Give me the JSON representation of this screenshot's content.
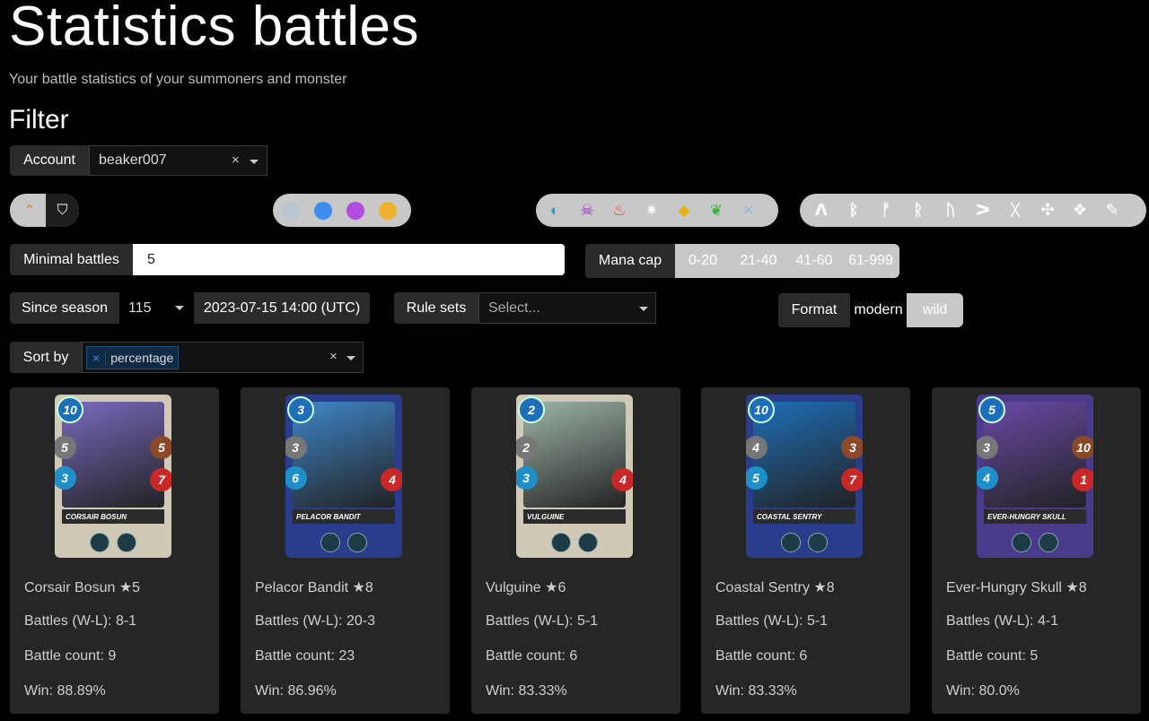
{
  "page": {
    "title": "Statistics battles",
    "subtitle": "Your battle statistics of your summoners and monster",
    "filter_heading": "Filter"
  },
  "filters": {
    "account_label": "Account",
    "account_value": "beaker007",
    "minimal_battles_label": "Minimal battles",
    "minimal_battles_value": "5",
    "mana_cap_label": "Mana cap",
    "mana_ranges": [
      "0-20",
      "21-40",
      "41-60",
      "61-999"
    ],
    "since_season_label": "Since season",
    "since_season_value": "115",
    "since_date": "2023-07-15 14:00 (UTC)",
    "rule_sets_label": "Rule sets",
    "rule_sets_placeholder": "Select...",
    "format_label": "Format",
    "format_options": [
      "modern",
      "wild"
    ],
    "format_selected": "wild",
    "sort_by_label": "Sort by",
    "sort_by_tag": "percentage",
    "card_type_icons": [
      "monster-icon",
      "summoner-icon"
    ],
    "rarity_colors": [
      "#b9c6d2",
      "#3c8cf0",
      "#b04ce0",
      "#f0b030"
    ],
    "element_icons": [
      "water-icon",
      "death-icon",
      "fire-icon",
      "life-icon",
      "earth-icon",
      "dragon-icon",
      "neutral-icon"
    ],
    "ability_icons": [
      "rune-1-icon",
      "rune-2-icon",
      "rune-3-icon",
      "rune-4-icon",
      "rune-5-icon",
      "rune-6-icon",
      "rune-7-icon",
      "rune-8-icon",
      "rune-9-icon",
      "rune-10-icon"
    ]
  },
  "cards": [
    {
      "name": "Corsair Bosun ★5",
      "plate": "CORSAIR BOSUN",
      "battles": "Battles (W-L): 8-1",
      "count": "Battle count: 9",
      "win": "Win: 88.89%",
      "mana": "10",
      "atk": "5",
      "speed": "3",
      "hp": "7",
      "armor": "5",
      "frame": "#cfc9b5",
      "art": "#7a6ac0"
    },
    {
      "name": "Pelacor Bandit ★8",
      "plate": "PELACOR BANDIT",
      "battles": "Battles (W-L): 20-3",
      "count": "Battle count: 23",
      "win": "Win: 86.96%",
      "mana": "3",
      "atk": "3",
      "speed": "6",
      "hp": "4",
      "armor": "",
      "frame": "#2a3c8c",
      "art": "#3f86c9"
    },
    {
      "name": "Vulguine ★6",
      "plate": "VULGUINE",
      "battles": "Battles (W-L): 5-1",
      "count": "Battle count: 6",
      "win": "Win: 83.33%",
      "mana": "2",
      "atk": "2",
      "speed": "3",
      "hp": "4",
      "armor": "",
      "frame": "#cfc9b5",
      "art": "#9fb5a8"
    },
    {
      "name": "Coastal Sentry ★8",
      "plate": "COASTAL SENTRY",
      "battles": "Battles (W-L): 5-1",
      "count": "Battle count: 6",
      "win": "Win: 83.33%",
      "mana": "10",
      "atk": "4",
      "speed": "5",
      "hp": "7",
      "armor": "3",
      "frame": "#2a3c8c",
      "art": "#1e6fb8"
    },
    {
      "name": "Ever-Hungry Skull ★8",
      "plate": "EVER-HUNGRY SKULL",
      "battles": "Battles (W-L): 4-1",
      "count": "Battle count: 5",
      "win": "Win: 80.0%",
      "mana": "5",
      "atk": "3",
      "speed": "4",
      "hp": "1",
      "armor": "10",
      "frame": "#4a3a8c",
      "art": "#6a4aa8"
    }
  ]
}
